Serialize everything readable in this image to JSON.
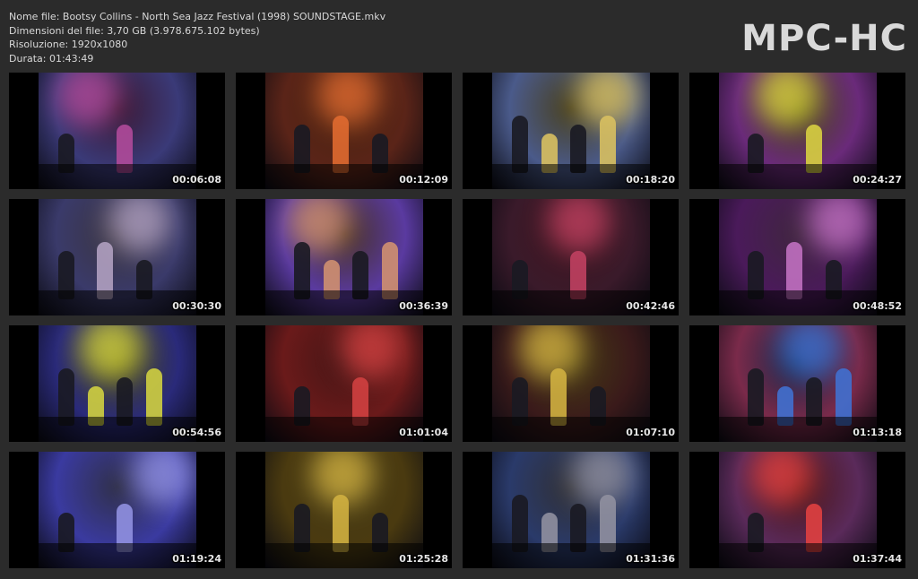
{
  "info": {
    "filename": "Nome file: Bootsy Collins - North Sea Jazz Festival (1998) SOUNDSTAGE.mkv",
    "filesize": "Dimensioni del file: 3,70 GB (3.978.675.102 bytes)",
    "resolution": "Risoluzione: 1920x1080",
    "duration": "Durata: 01:43:49"
  },
  "logo": "MPC-HC",
  "thumbnails": [
    {
      "time": "00:06:08",
      "bg": "#3a3a78",
      "accent": "#b04a9a"
    },
    {
      "time": "00:12:09",
      "bg": "#5a2418",
      "accent": "#e06a30"
    },
    {
      "time": "00:18:20",
      "bg": "#4a5a8a",
      "accent": "#d8c060"
    },
    {
      "time": "00:24:27",
      "bg": "#6a2a7a",
      "accent": "#d8d040"
    },
    {
      "time": "00:30:30",
      "bg": "#3a3a6a",
      "accent": "#b0a0c0"
    },
    {
      "time": "00:36:39",
      "bg": "#5a3aa0",
      "accent": "#d09070"
    },
    {
      "time": "00:42:46",
      "bg": "#3a1a2a",
      "accent": "#c04060"
    },
    {
      "time": "00:48:52",
      "bg": "#4a1a5a",
      "accent": "#c070c0"
    },
    {
      "time": "00:54:56",
      "bg": "#2a2a7a",
      "accent": "#d0d040"
    },
    {
      "time": "01:01:04",
      "bg": "#6a1a1a",
      "accent": "#d04040"
    },
    {
      "time": "01:07:10",
      "bg": "#3a1a1a",
      "accent": "#d0b040"
    },
    {
      "time": "01:13:18",
      "bg": "#7a2a4a",
      "accent": "#4070d0"
    },
    {
      "time": "01:19:24",
      "bg": "#3a3aa0",
      "accent": "#9090e0"
    },
    {
      "time": "01:25:28",
      "bg": "#4a3a10",
      "accent": "#d0b040"
    },
    {
      "time": "01:31:36",
      "bg": "#2a3a6a",
      "accent": "#9090a0"
    },
    {
      "time": "01:37:44",
      "bg": "#5a2a5a",
      "accent": "#e04040"
    }
  ]
}
